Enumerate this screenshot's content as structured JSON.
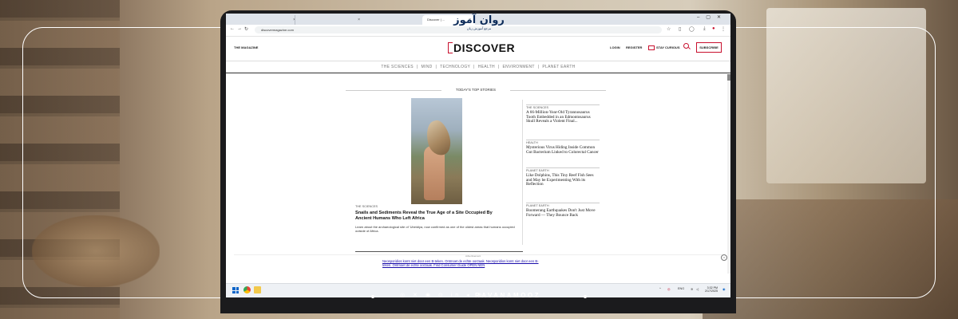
{
  "browser": {
    "tabs": [
      "",
      "",
      "Discover | ..."
    ],
    "url": "discovermagazine.com"
  },
  "site": {
    "magazine_label": "THE MAGAZINE",
    "logo": "DISCOVER",
    "login": "LOGIN",
    "register": "REGISTER",
    "stay_curious": "STAY CURIOUS",
    "subscribe": "SUBSCRIBE",
    "nav": [
      "THE SCIENCES",
      "|",
      "MIND",
      "|",
      "TECHNOLOGY",
      "|",
      "HEALTH",
      "|",
      "ENVIRONMENT",
      "|",
      "PLANET EARTH"
    ]
  },
  "content": {
    "section_title": "TODAY'S TOP STORIES",
    "hero": {
      "category": "THE SCIENCES",
      "title": "Snails and Sediments Reveal the True Age of a Site Occupied By Ancient Humans Who Left Africa",
      "description": "Learn about the archaeological site of 'Ubeidiya, now confirmed as one of the oldest areas that humans occupied outside of Africa."
    },
    "side_stories": [
      {
        "category": "THE SCIENCES",
        "title": "A 66-Million-Year-Old Tyrannosaurus Tooth Embedded in an Edmontosaurus Skull Reveals a Violent Final..."
      },
      {
        "category": "HEALTH",
        "title": "Mysterious Virus Hiding Inside Common Gut Bacterium Linked to Colorectal Cancer"
      },
      {
        "category": "PLANET EARTH",
        "title": "Like Dolphins, This Tiny Reef Fish Sees and May be Experimenting With its Reflection"
      },
      {
        "category": "PLANET EARTH",
        "title": "Boomerang Earthquakes Don't Just Move Forward — They Bounce Back"
      }
    ],
    "ad_label": "Advertisement",
    "ad_text": "Neosporidios komt niet door een B-teken. Ontmoet de echte oorzaak. Neosporidios komt niet door een B-teken. Ontmoet de echte oorzaak. Find Consumer Guide OPEN NEN"
  },
  "taskbar": {
    "tray_lang": "ENG",
    "time": "3:32 PM",
    "date": "2/17/2025"
  },
  "overlay": {
    "brand": "روان آموز",
    "brand_sub": "مرجع آموزش زبان",
    "footer_icons": "◎ ✕ ◉ ⊙ in ◂ ⊕",
    "footer_text": "RAVANAMOOZ"
  },
  "colors": {
    "accent": "#c8102e",
    "brand": "#0d2c5a"
  }
}
